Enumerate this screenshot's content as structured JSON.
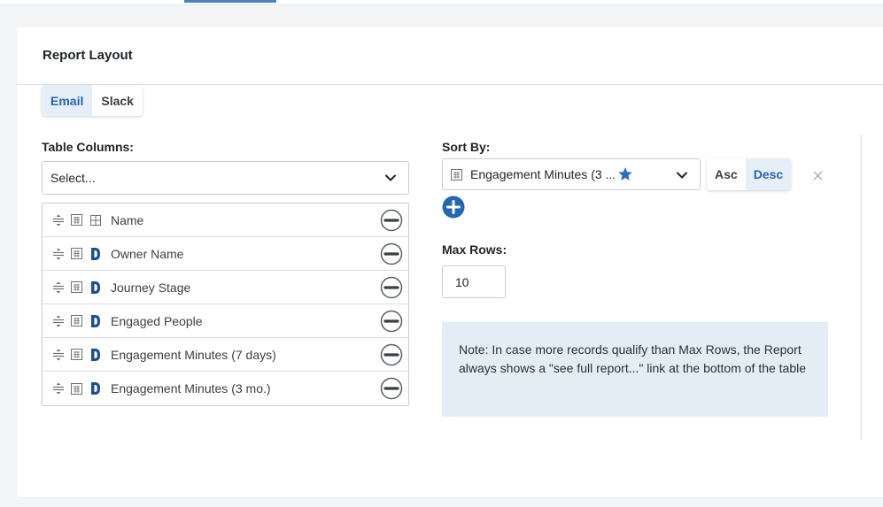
{
  "card": {
    "title": "Report Layout"
  },
  "channel_toggle": {
    "options": [
      "Email",
      "Slack"
    ],
    "selected": "Email"
  },
  "table_columns": {
    "label": "Table Columns:",
    "select_placeholder": "Select...",
    "items": [
      {
        "label": "Name",
        "icon": "grid-icon"
      },
      {
        "label": "Owner Name",
        "icon": "d-logo-icon"
      },
      {
        "label": "Journey Stage",
        "icon": "d-logo-icon"
      },
      {
        "label": "Engaged People",
        "icon": "d-logo-icon"
      },
      {
        "label": "Engagement Minutes (7 days)",
        "icon": "d-logo-icon"
      },
      {
        "label": "Engagement Minutes (3 mo.)",
        "icon": "d-logo-icon"
      }
    ]
  },
  "sort_by": {
    "label": "Sort By:",
    "selected_value": "Engagement Minutes (3 ...",
    "order_options": [
      "Asc",
      "Desc"
    ],
    "order_selected": "Desc"
  },
  "max_rows": {
    "label": "Max Rows:",
    "value": "10"
  },
  "note": {
    "text": "Note: In case more records qualify than Max Rows, the Report always shows a \"see full report...\" link at the bottom of the table"
  },
  "colors": {
    "accent": "#2466b0",
    "accent_bg": "#e6eef8",
    "note_bg": "#e4edf6",
    "star": "#2d6bc4"
  }
}
